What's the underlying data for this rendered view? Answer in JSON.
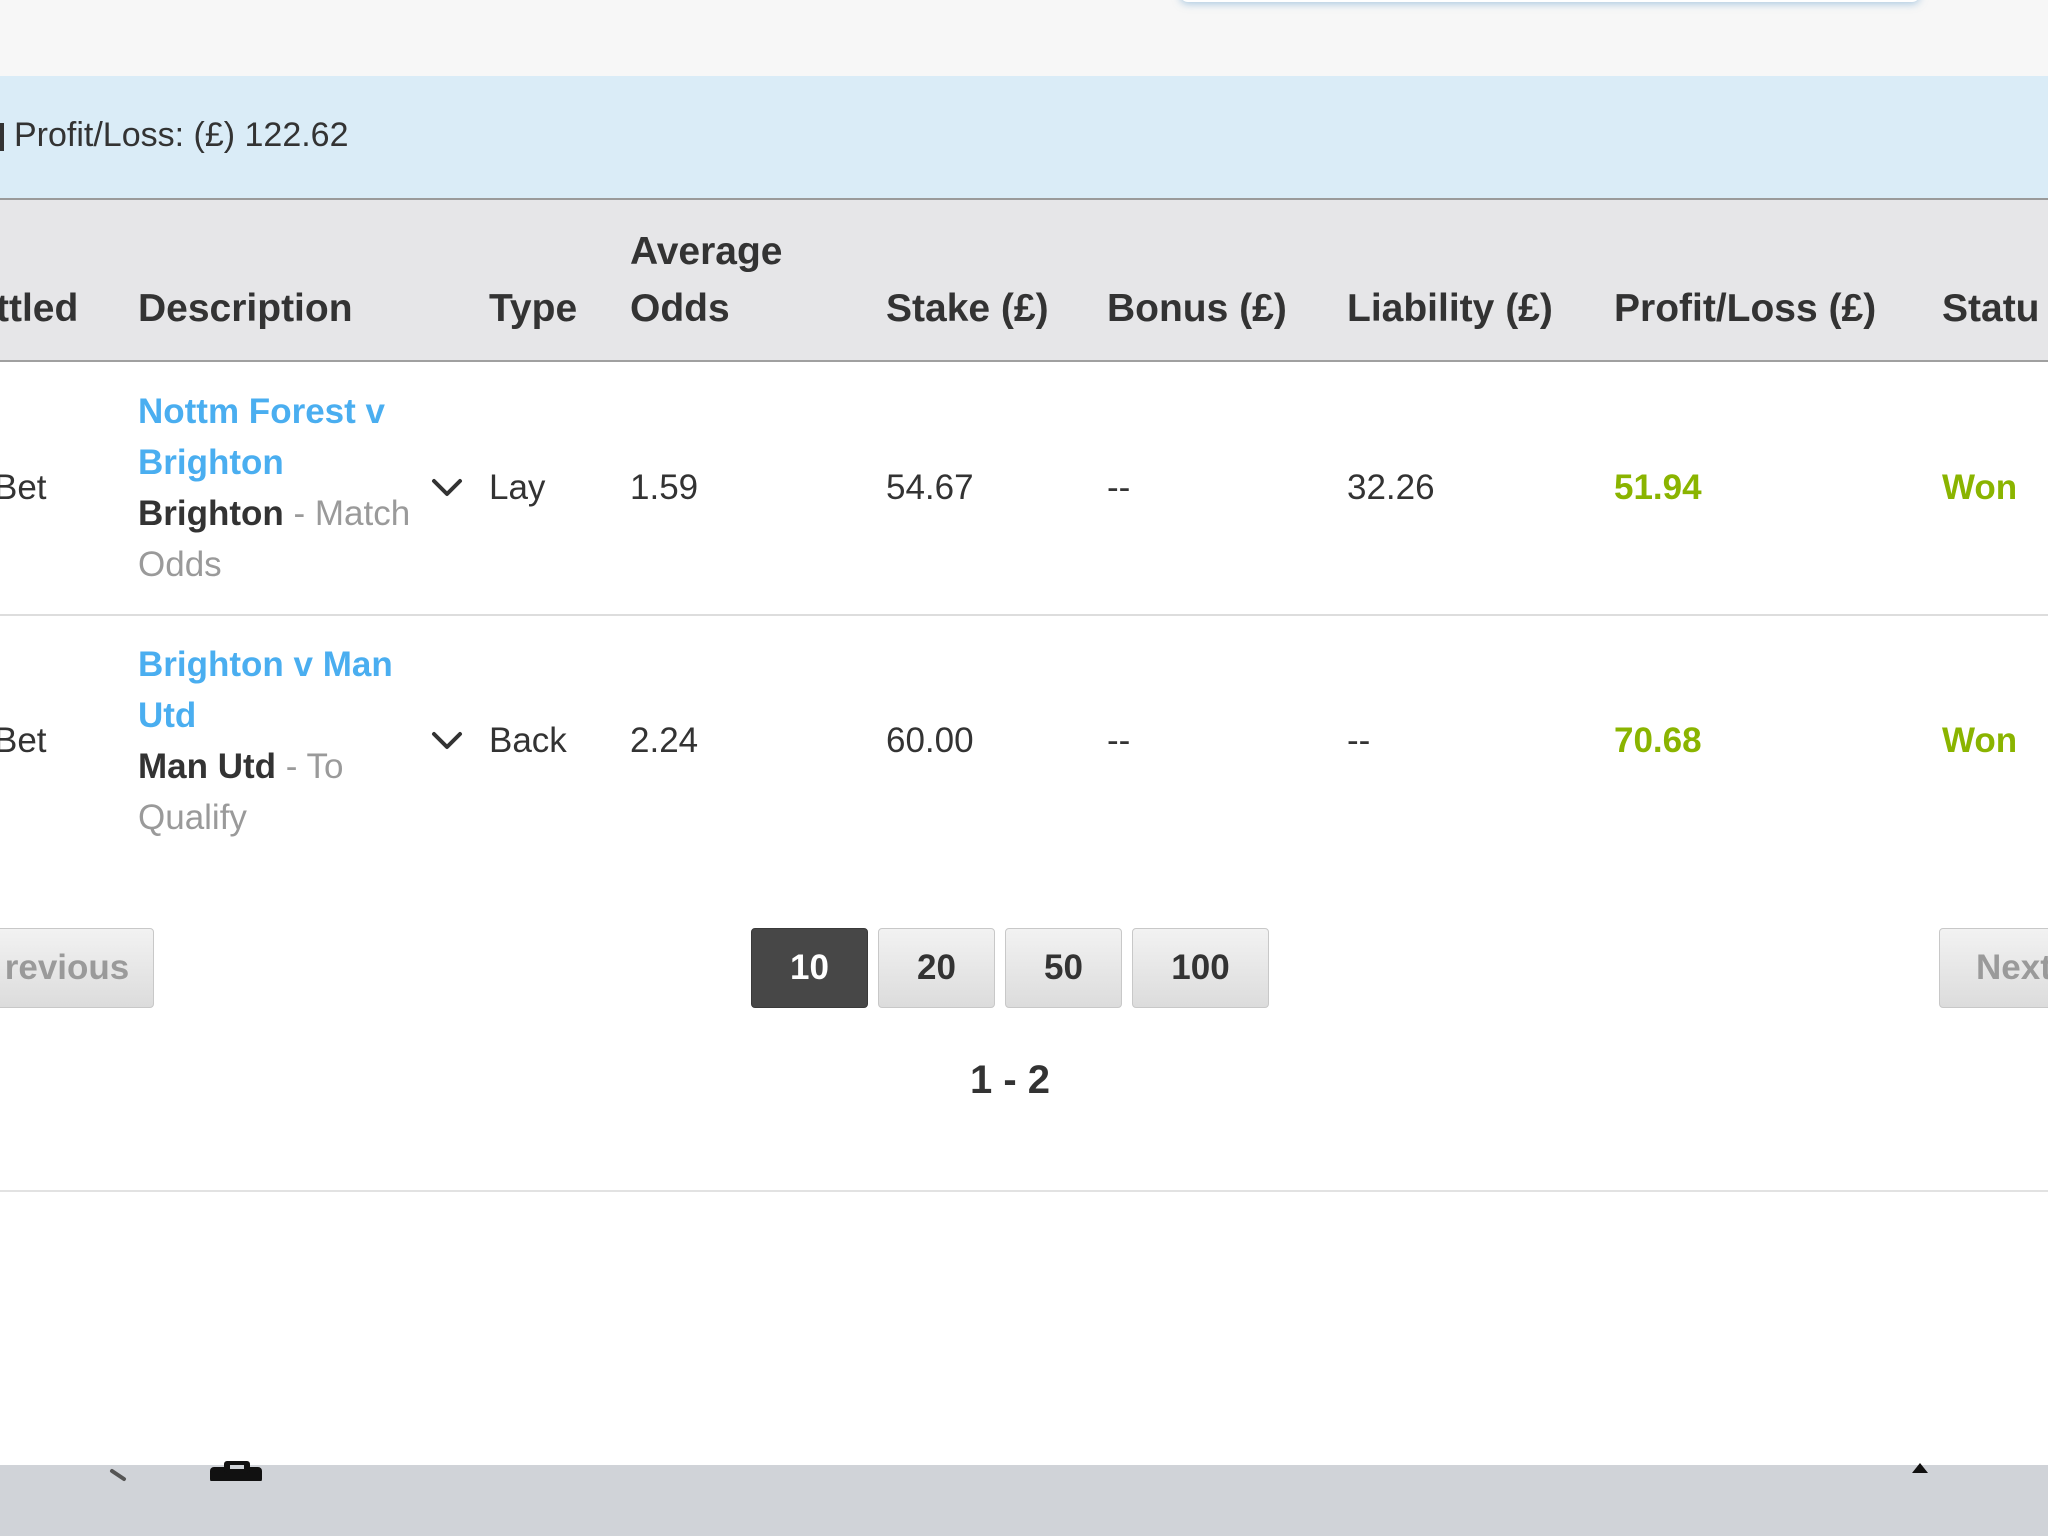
{
  "summary": {
    "text": "Profit/Loss: (£) 122.62"
  },
  "table": {
    "headers": {
      "settled": "ttled",
      "description": "Description",
      "type": "Type",
      "avg_odds_line1": "Average",
      "avg_odds_line2": "Odds",
      "stake": "Stake (£)",
      "bonus": "Bonus (£)",
      "liability": "Liability (£)",
      "profit_loss": "Profit/Loss (£)",
      "status": "Statu"
    },
    "rows": [
      {
        "settled": "Bet",
        "event": "Nottm Forest v Brighton",
        "selection": "Brighton",
        "separator": " - ",
        "market": "Match Odds",
        "type": "Lay",
        "avg_odds": "1.59",
        "stake": "54.67",
        "bonus": "--",
        "liability": "32.26",
        "profit_loss": "51.94",
        "status": "Won"
      },
      {
        "settled": "Bet",
        "event": "Brighton v Man Utd",
        "selection": "Man Utd",
        "separator": " - ",
        "market": "To Qualify",
        "type": "Back",
        "avg_odds": "2.24",
        "stake": "60.00",
        "bonus": "--",
        "liability": "--",
        "profit_loss": "70.68",
        "status": "Won"
      }
    ]
  },
  "pagination": {
    "previous": "revious",
    "next": "Next",
    "page_sizes": [
      "10",
      "20",
      "50",
      "100"
    ],
    "active_page_size": "10",
    "range": "1 - 2"
  },
  "colors": {
    "link": "#4aaef0",
    "positive": "#8ab400",
    "summary_bg": "#daecf7",
    "header_bg": "#e6e6e8",
    "active_button": "#474747"
  },
  "icons": {
    "expand": "chevron-down-icon"
  }
}
